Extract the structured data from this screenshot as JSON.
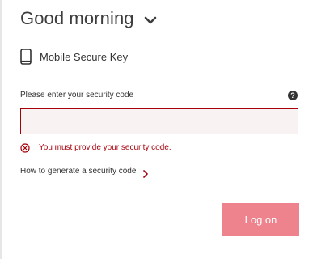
{
  "header": {
    "greeting": "Good morning",
    "chevron_icon": "chevron-down-icon"
  },
  "auth_method": {
    "icon": "mobile-phone-icon",
    "label": "Mobile Secure Key"
  },
  "security_code": {
    "label": "Please enter your security code",
    "help_icon": "help-icon",
    "help_glyph": "?",
    "value": "",
    "placeholder": "",
    "error_icon": "error-circle-icon",
    "error_message": "You must provide your security code."
  },
  "help_link": {
    "label": "How to generate a security code",
    "icon": "chevron-right-icon"
  },
  "actions": {
    "logon_label": "Log on"
  },
  "colors": {
    "accent_red": "#a8000b",
    "input_error_bg": "#f9f2f3",
    "button_disabled": "#ee838e",
    "text": "#333333"
  }
}
